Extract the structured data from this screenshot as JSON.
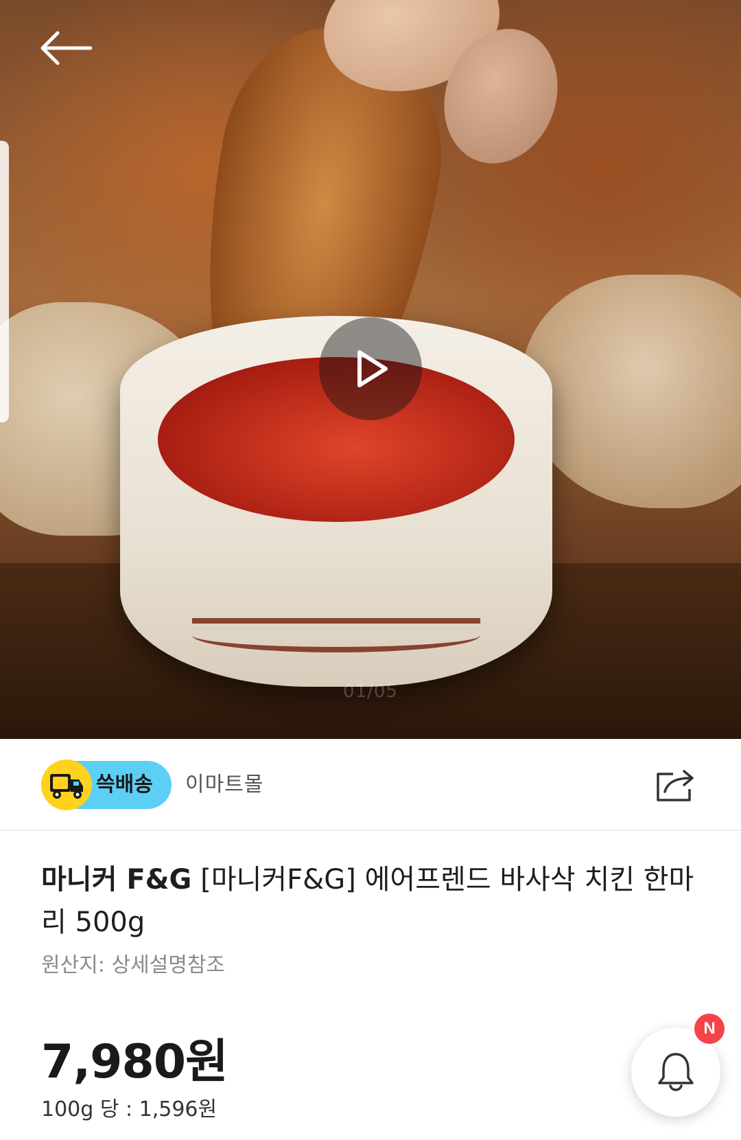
{
  "hero": {
    "page_indicator": "01/05"
  },
  "store": {
    "delivery_badge_label": "쓱배송",
    "store_name": "이마트몰"
  },
  "product": {
    "brand": "마니커 F&G",
    "title": "[마니커F&G] 에어프렌드  바사삭 치킨 한마리 500g",
    "origin": "원산지: 상세설명참조",
    "price": "7,980원",
    "unit_price": "100g 당 : 1,596원"
  },
  "alert": {
    "badge": "N"
  },
  "colors": {
    "delivery_badge": "#5ccff5",
    "truck_circle": "#ffd21e",
    "new_badge": "#f5434a"
  },
  "icons": {
    "back": "back-arrow-icon",
    "play": "play-icon",
    "share": "share-icon",
    "bell": "bell-icon",
    "truck": "truck-icon"
  }
}
